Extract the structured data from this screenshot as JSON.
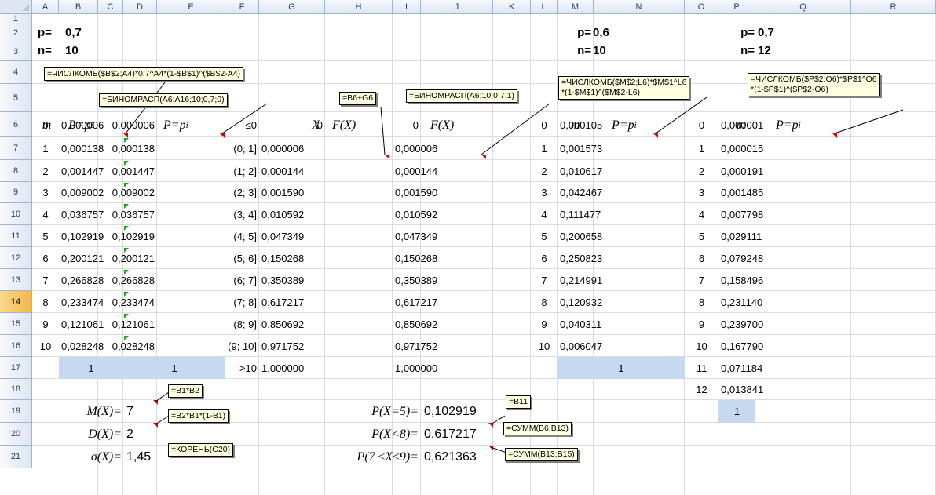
{
  "columns": [
    "A",
    "B",
    "C",
    "D",
    "E",
    "F",
    "G",
    "H",
    "I",
    "J",
    "K",
    "L",
    "M",
    "N",
    "O",
    "P",
    "Q",
    "R"
  ],
  "rows": [
    "1",
    "2",
    "3",
    "4",
    "5",
    "6",
    "7",
    "8",
    "9",
    "10",
    "11",
    "12",
    "13",
    "14",
    "15",
    "16",
    "17",
    "18",
    "19",
    "20",
    "21"
  ],
  "selected_row": "14",
  "params": {
    "p1_label": "p=",
    "p1_value": "0,7",
    "n1_label": "n=",
    "n1_value": "10",
    "p2_label": "p=",
    "p2_value": "0,6",
    "n2_label": "n=",
    "n2_value": "10",
    "p3_label": "p=",
    "p3_value": "0,7",
    "n3_label": "n=",
    "n3_value": "12"
  },
  "headers": {
    "m": "m",
    "P": "P=p",
    "P_sub": "i",
    "X": "X",
    "FX": "F(X)"
  },
  "table1": {
    "m": [
      "0",
      "1",
      "2",
      "3",
      "4",
      "5",
      "6",
      "7",
      "8",
      "9",
      "10"
    ],
    "B": [
      "0,000006",
      "0,000138",
      "0,001447",
      "0,009002",
      "0,036757",
      "0,102919",
      "0,200121",
      "0,266828",
      "0,233474",
      "0,121061",
      "0,028248"
    ],
    "D": [
      "0,000006",
      "0,000138",
      "0,001447",
      "0,009002",
      "0,036757",
      "0,102919",
      "0,200121",
      "0,266828",
      "0,233474",
      "0,121061",
      "0,028248"
    ],
    "X": [
      "≤0",
      "(0; 1]",
      "(1; 2]",
      "(2; 3]",
      "(3; 4]",
      "(4; 5]",
      "(5; 6]",
      "(6; 7]",
      "(7; 8]",
      "(8; 9]",
      "(9; 10]",
      ">10"
    ],
    "G": [
      "0",
      "0,000006",
      "0,000144",
      "0,001590",
      "0,010592",
      "0,047349",
      "0,150268",
      "0,350389",
      "0,617217",
      "0,850692",
      "0,971752",
      "1,000000"
    ],
    "I": [
      "0",
      "0,000006",
      "0,000144",
      "0,001590",
      "0,010592",
      "0,047349",
      "0,150268",
      "0,350389",
      "0,617217",
      "0,850692",
      "0,971752",
      "1,000000"
    ],
    "sum_B": "1",
    "sum_D": "1"
  },
  "table2": {
    "m": [
      "0",
      "1",
      "2",
      "3",
      "4",
      "5",
      "6",
      "7",
      "8",
      "9",
      "10"
    ],
    "M": [
      "0,000105",
      "0,001573",
      "0,010617",
      "0,042467",
      "0,111477",
      "0,200658",
      "0,250823",
      "0,214991",
      "0,120932",
      "0,040311",
      "0,006047"
    ],
    "sum": "1"
  },
  "table3": {
    "m": [
      "0",
      "1",
      "2",
      "3",
      "4",
      "5",
      "6",
      "7",
      "8",
      "9",
      "10",
      "11",
      "12"
    ],
    "P": [
      "0,000001",
      "0,000015",
      "0,000191",
      "0,001485",
      "0,007798",
      "0,029111",
      "0,079248",
      "0,158496",
      "0,231140",
      "0,239700",
      "0,167790",
      "0,071184",
      "0,013841"
    ],
    "sum": "1"
  },
  "stats": {
    "MX_label": "M(X)=",
    "MX_value": "7",
    "DX_label": "D(X)=",
    "DX_value": "2",
    "sigma_label": "σ(X)=",
    "sigma_value": "1,45",
    "p5_label": "P(X=5)=",
    "p5_value": "0,102919",
    "plt8_label": "P(X<8)=",
    "plt8_value": "0,617217",
    "p79_label": "P(7 ≤X≤9)=",
    "p79_value": "0,621363"
  },
  "notes": {
    "n1": "=ЧИСЛКОМБ($B$2;A4)*0,7^A4*(1-$B$1)^($B$2-A4)",
    "n2": "=БИНОМРАСП(A6:A16;10;0,7;0)",
    "n3": "=B6+G6",
    "n4": "=БИНОМРАСП(A6;10;0,7;1)",
    "n5_l1": "=ЧИСЛКОМБ($M$2;L6)*$M$1^L6",
    "n5_l2": "*(1-$M$1)^($M$2-L6)",
    "n6_l1": "=ЧИСЛКОМБ($P$2;O6)*$P$1^O6",
    "n6_l2": "*(1-$P$1)^($P$2-O6)",
    "n7": "=B1*B2",
    "n8": "=B2*B1*(1-B1)",
    "n9": "=КОРЕНЬ(C20)",
    "n10": "=B11",
    "n11": "=СУММ(B6:B13)",
    "n12": "=СУММ(B13:B15)"
  },
  "colors": {
    "header_bg": "#dde6f2",
    "sum_fill": "#c6d9f0",
    "note_bg": "#ffffe1",
    "comment_mark": "#e00000",
    "error_mark": "#1ca31c"
  }
}
